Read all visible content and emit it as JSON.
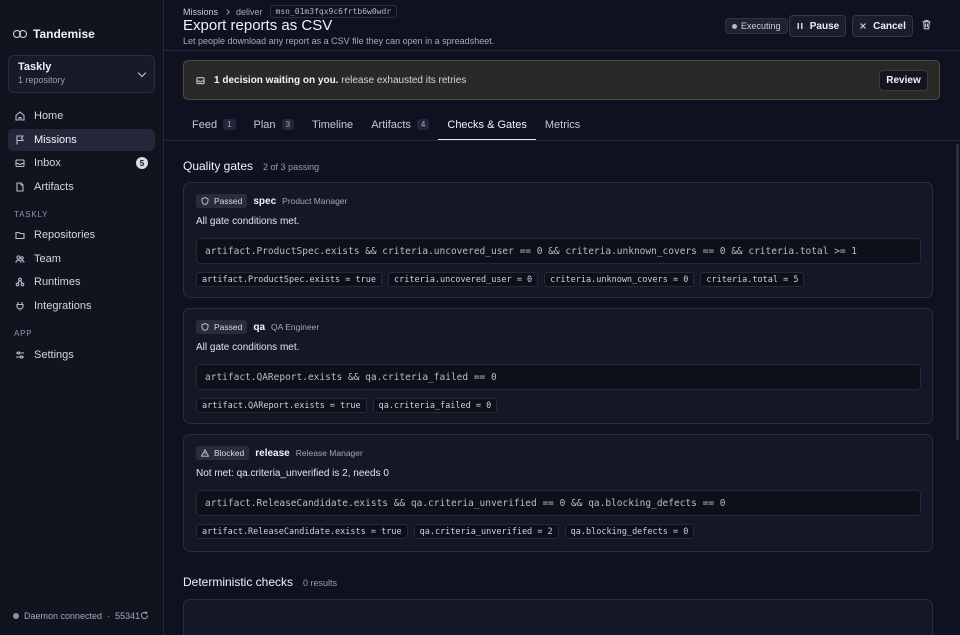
{
  "sidebar": {
    "brand": "Tandemise",
    "workspace": {
      "name": "Taskly",
      "sub": "1 repository"
    },
    "primary_nav": [
      {
        "label": "Home",
        "icon": "home-icon"
      },
      {
        "label": "Missions",
        "icon": "flag-icon",
        "active": true
      },
      {
        "label": "Inbox",
        "icon": "inbox-icon",
        "badge": "5"
      },
      {
        "label": "Artifacts",
        "icon": "file-icon"
      }
    ],
    "workspace_section": "TASKLY",
    "workspace_nav": [
      {
        "label": "Repositories",
        "icon": "folder-icon"
      },
      {
        "label": "Team",
        "icon": "team-icon"
      },
      {
        "label": "Runtimes",
        "icon": "runtime-icon"
      },
      {
        "label": "Integrations",
        "icon": "plug-icon"
      }
    ],
    "app_section": "APP",
    "app_nav": [
      {
        "label": "Settings",
        "icon": "sliders-icon"
      }
    ],
    "daemon": {
      "status": "Daemon connected",
      "port": "55341"
    }
  },
  "header": {
    "breadcrumb": [
      "Missions",
      "deliver"
    ],
    "mission_id": "msn_01m3fqx9c6frtb6w0wdr",
    "title": "Export reports as CSV",
    "subtitle": "Let people download any report as a CSV file they can open in a spreadsheet.",
    "status": "Executing",
    "pause_label": "Pause",
    "cancel_label": "Cancel"
  },
  "decision_banner": {
    "bold": "1 decision waiting on you.",
    "text": "release exhausted its retries",
    "button": "Review"
  },
  "tabs": [
    {
      "label": "Feed",
      "count": "1"
    },
    {
      "label": "Plan",
      "count": "3"
    },
    {
      "label": "Timeline"
    },
    {
      "label": "Artifacts",
      "count": "4"
    },
    {
      "label": "Checks & Gates",
      "active": true
    },
    {
      "label": "Metrics"
    }
  ],
  "quality_gates": {
    "title": "Quality gates",
    "summary": "2 of 3 passing",
    "gates": [
      {
        "status": "Passed",
        "status_icon": "shield-icon",
        "name": "spec",
        "role": "Product Manager",
        "message": "All gate conditions met.",
        "expression": "artifact.ProductSpec.exists && criteria.uncovered_user == 0 && criteria.unknown_covers == 0 && criteria.total >= 1",
        "values": [
          "artifact.ProductSpec.exists = true",
          "criteria.uncovered_user = 0",
          "criteria.unknown_covers = 0",
          "criteria.total = 5"
        ]
      },
      {
        "status": "Passed",
        "status_icon": "shield-icon",
        "name": "qa",
        "role": "QA Engineer",
        "message": "All gate conditions met.",
        "expression": "artifact.QAReport.exists && qa.criteria_failed == 0",
        "values": [
          "artifact.QAReport.exists = true",
          "qa.criteria_failed = 0"
        ]
      },
      {
        "status": "Blocked",
        "status_icon": "warning-icon",
        "name": "release",
        "role": "Release Manager",
        "message": "Not met: qa.criteria_unverified is 2, needs 0",
        "expression": "artifact.ReleaseCandidate.exists && qa.criteria_unverified == 0 && qa.blocking_defects == 0",
        "values": [
          "artifact.ReleaseCandidate.exists = true",
          "qa.criteria_unverified = 2",
          "qa.blocking_defects = 0"
        ]
      }
    ]
  },
  "deterministic_checks": {
    "title": "Deterministic checks",
    "summary": "0 results"
  },
  "colors": {
    "background": "#0f1120",
    "sidebar": "#11131f",
    "card": "#151727",
    "banner": "#292927",
    "text": "#e4e6ee"
  }
}
